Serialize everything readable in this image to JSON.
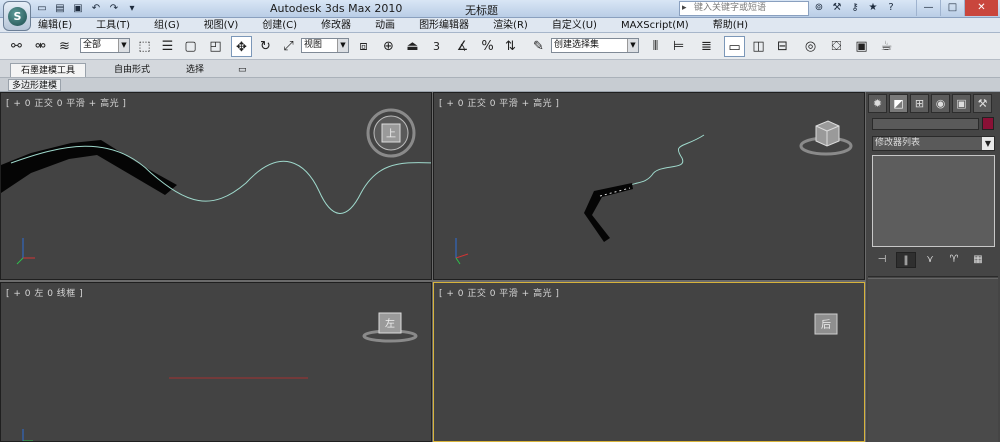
{
  "titlebar": {
    "app_logo_letter": "S",
    "quick_access": [
      "new-file-icon",
      "open-file-icon",
      "save-icon",
      "undo-icon",
      "redo-icon",
      "more-icon"
    ],
    "title": "Autodesk 3ds Max  2010",
    "file": "无标题",
    "search_placeholder": "键入关键字或短语",
    "icons": [
      "binoculars-icon",
      "wrench-icon",
      "key-icon",
      "star-icon",
      "help-icon"
    ]
  },
  "menu": [
    "编辑(E)",
    "工具(T)",
    "组(G)",
    "视图(V)",
    "创建(C)",
    "修改器",
    "动画",
    "图形编辑器",
    "渲染(R)",
    "自定义(U)",
    "MAXScript(M)",
    "帮助(H)"
  ],
  "toolbar": {
    "selection_filter": "全部",
    "reference_coord": "视图",
    "snap_value": "3",
    "named_selection": "创建选择集"
  },
  "ribbon": {
    "tabs": [
      "石墨建模工具",
      "自由形式",
      "选择"
    ],
    "active_tab": "石墨建模工具",
    "sub_tab": "多边形建模"
  },
  "viewports": {
    "top_left": {
      "label": "[ + 0 正交 0 平滑 + 高光 ]",
      "cube_label": "上"
    },
    "top_right": {
      "label": "[ + 0 正交 0 平滑 + 高光 ]"
    },
    "bottom_left": {
      "label": "[ + 0 左 0 线框 ]",
      "cube_label": "左"
    },
    "bottom_right": {
      "label": "[ + 0 正交 0 平滑 + 高光 ]",
      "cube_label": "后"
    }
  },
  "command_panel": {
    "tabs": [
      "create-icon",
      "modify-icon",
      "hierarchy-icon",
      "motion-icon",
      "display-icon",
      "utilities-icon"
    ],
    "modifier_list": "修改器列表",
    "object_color": "#8a1136"
  },
  "colors": {
    "viewport_bg": "#434343",
    "active_border": "#d7b33b",
    "spline": "#9fd9cc"
  }
}
